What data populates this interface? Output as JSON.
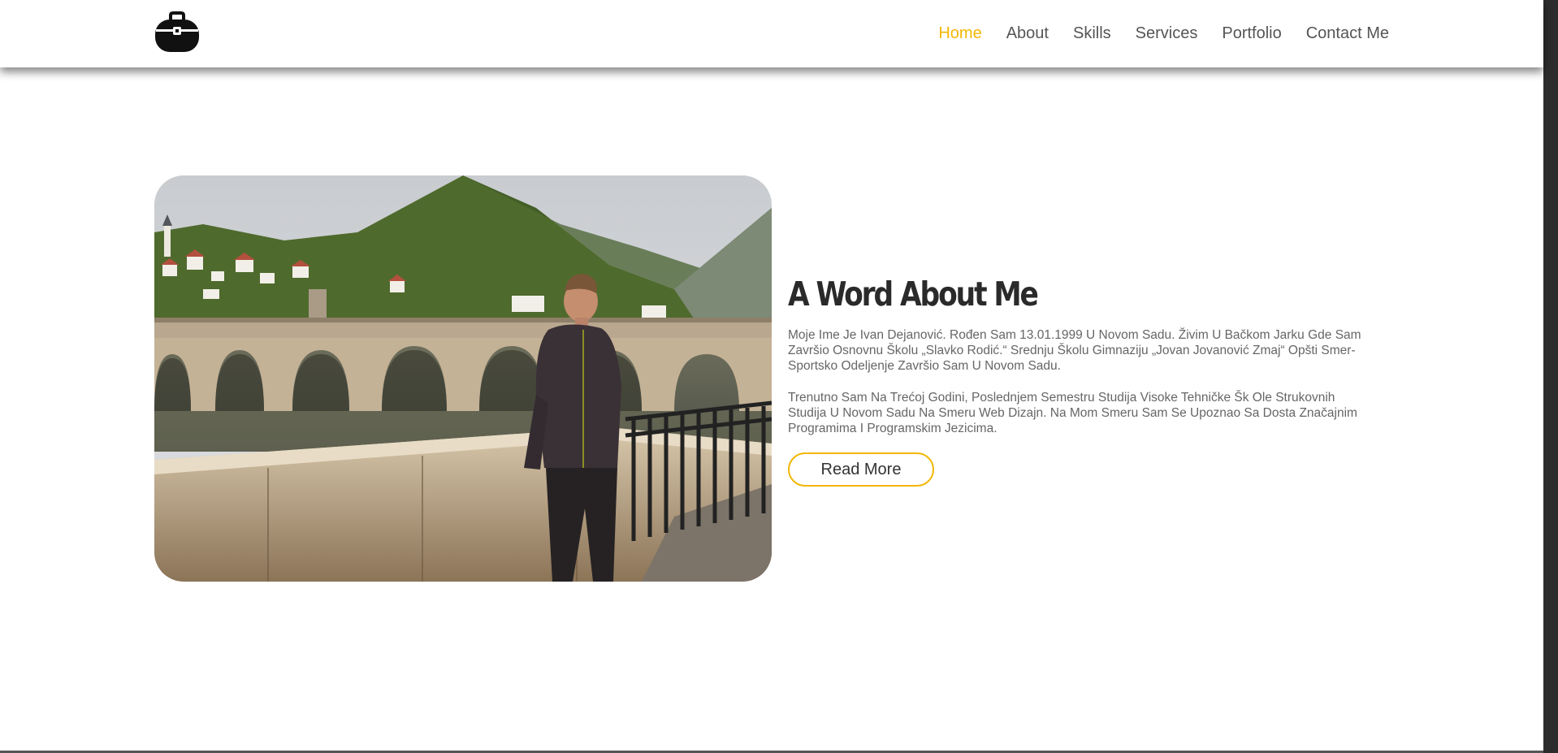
{
  "colors": {
    "accent": "#f2b705",
    "nav_text": "#555555",
    "heading": "#2a2a2a",
    "body_text": "#666666"
  },
  "logo": {
    "icon": "briefcase-icon"
  },
  "nav": {
    "items": [
      {
        "label": "Home",
        "active": true
      },
      {
        "label": "About",
        "active": false
      },
      {
        "label": "Skills",
        "active": false
      },
      {
        "label": "Services",
        "active": false
      },
      {
        "label": "Portfolio",
        "active": false
      },
      {
        "label": "Contact Me",
        "active": false
      }
    ]
  },
  "about": {
    "title": "A Word About Me",
    "paragraph1": "Moje Ime Je Ivan Dejanović. Rođen Sam 13.01.1999 U Novom Sadu. Živim U Bačkom Jarku Gde Sam Završio Osnovnu Školu „Slavko Rodić.“ Srednju Školu Gimnaziju „Jovan Jovanović Zmaj“ Opšti Smer-Sportsko Odeljenje Završio Sam U Novom Sadu.",
    "paragraph2": "Trenutno Sam Na Trećoj Godini, Poslednjem Semestru Studija Visoke Tehničke Šk Ole Strukovnih Studija U Novom Sadu Na Smeru Web Dizajn. Na Mom Smeru Sam Se Upoznao Sa Dosta Značajnim Programima I Programskim Jezicima.",
    "button_label": "Read More"
  }
}
